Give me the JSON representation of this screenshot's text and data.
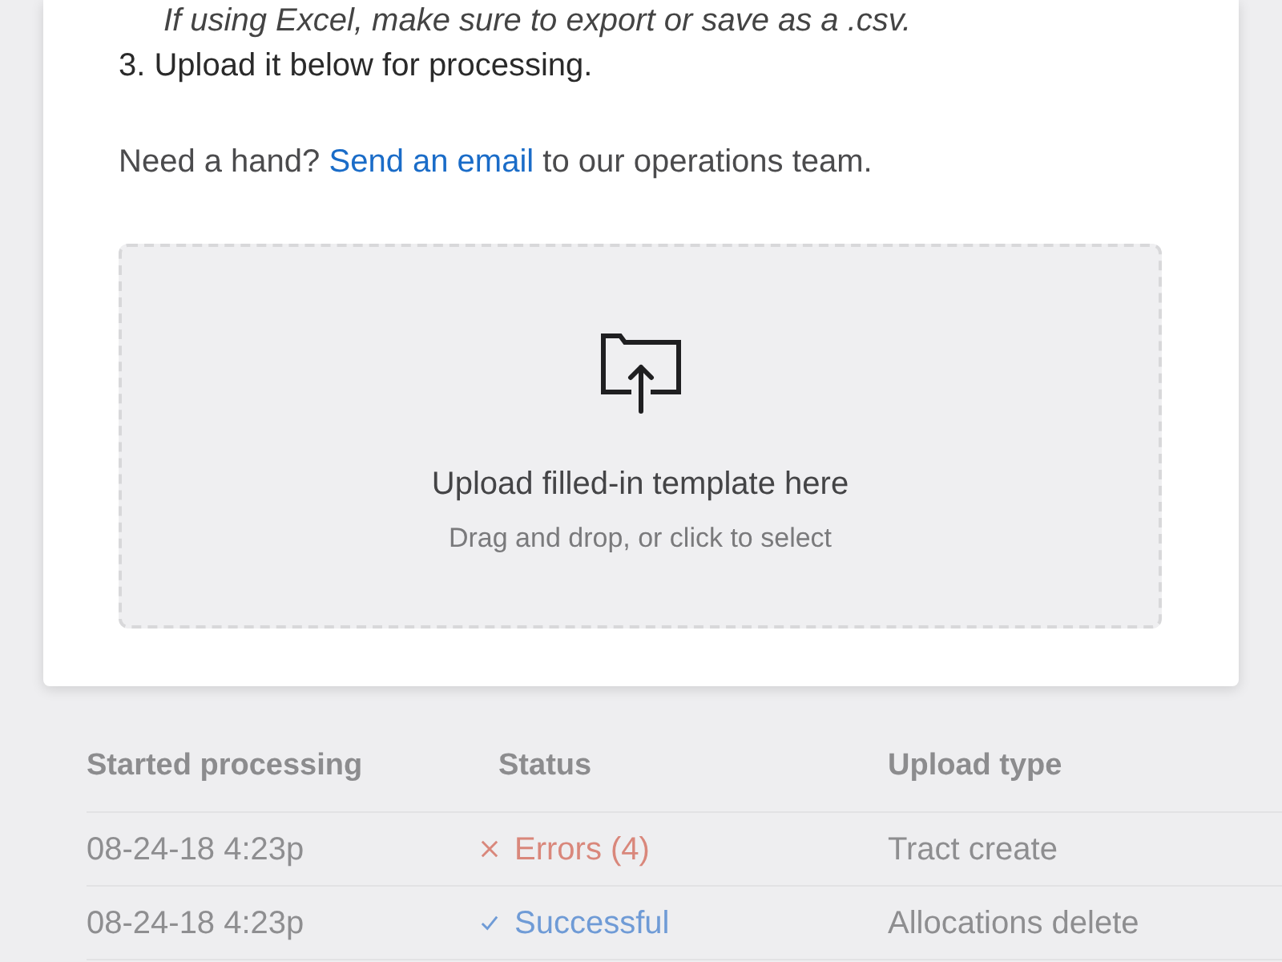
{
  "instructions": {
    "note": "If using Excel, make sure to export or save as a .csv.",
    "step": "3. Upload it below for processing."
  },
  "help": {
    "lead": "Need a hand?",
    "link": "Send an email",
    "rest": "to our operations team."
  },
  "dropzone": {
    "title": "Upload filled-in template here",
    "hint": "Drag and drop, or click to select"
  },
  "table": {
    "columns": [
      "Started processing",
      "Status",
      "Upload type"
    ],
    "rows": [
      {
        "started": "08-24-18 4:23p",
        "status": {
          "kind": "error",
          "label": "Errors (4)"
        },
        "upload_type": "Tract create"
      },
      {
        "started": "08-24-18 4:23p",
        "status": {
          "kind": "success",
          "label": "Successful"
        },
        "upload_type": "Allocations delete"
      }
    ]
  }
}
